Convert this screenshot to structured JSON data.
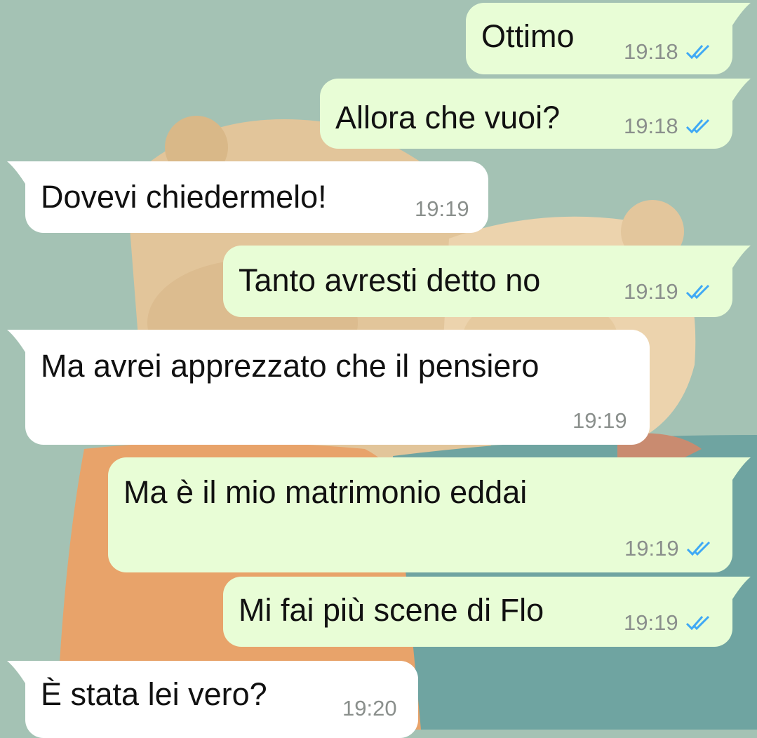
{
  "chat": {
    "messages": [
      {
        "direction": "outgoing",
        "text": "Ottimo",
        "time": "19:18",
        "status": "read-double-check-icon"
      },
      {
        "direction": "outgoing",
        "text": "Allora che vuoi?",
        "time": "19:18",
        "status": "read-double-check-icon"
      },
      {
        "direction": "incoming",
        "text": "Dovevi chiedermelo!",
        "time": "19:19"
      },
      {
        "direction": "outgoing",
        "text": "Tanto avresti detto no",
        "time": "19:19",
        "status": "read-double-check-icon"
      },
      {
        "direction": "incoming",
        "text": "Ma avrei apprezzato che il pensiero",
        "time": "19:19"
      },
      {
        "direction": "outgoing",
        "text": "Ma è il mio matrimonio eddai",
        "time": "19:19",
        "status": "read-double-check-icon"
      },
      {
        "direction": "outgoing",
        "text": "Mi fai più scene di Flo",
        "time": "19:19",
        "status": "read-double-check-icon"
      },
      {
        "direction": "incoming",
        "text": "È stata lei vero?",
        "time": "19:20"
      }
    ]
  },
  "colors": {
    "outgoing_bubble": "#e8fdd6",
    "incoming_bubble": "#ffffff",
    "read_ticks": "#3fa9f5",
    "timestamp": "#8a8f8c"
  },
  "wallpaper": {
    "subject": "two-teddy-bears-hugging-illustration"
  }
}
